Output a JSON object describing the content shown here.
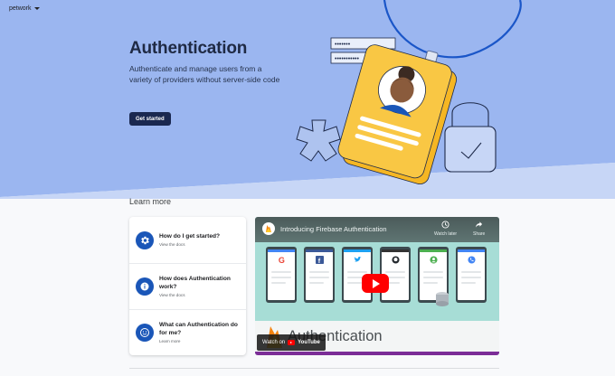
{
  "topbar": {
    "project_label": "petwork"
  },
  "hero": {
    "title": "Authentication",
    "description": "Authenticate and manage users from a variety of providers without server-side code",
    "cta_label": "Get started",
    "password_mask_1": "•••••••",
    "password_mask_2": "•••••••••••"
  },
  "learn_more": {
    "heading": "Learn more",
    "items": [
      {
        "question": "How do I get started?",
        "link": "View the docs",
        "icon": "gear-icon"
      },
      {
        "question": "How does Authentication work?",
        "link": "View the docs",
        "icon": "info-icon"
      },
      {
        "question": "What can Authentication do for me?",
        "link": "Learn more",
        "icon": "smiley-icon"
      }
    ]
  },
  "video": {
    "title": "Introducing Firebase Authentication",
    "watch_later": "Watch later",
    "share": "Share",
    "bottom_title": "Authentication",
    "watch_on": "Watch on",
    "youtube": "YouTube",
    "providers": [
      "google-logo",
      "facebook-logo",
      "twitter-logo",
      "github-logo",
      "anonymous-logo",
      "phone-logo"
    ]
  },
  "colors": {
    "hero_bg": "#9bb6f0",
    "hero_dark": "#1a2850",
    "badge_yellow": "#f5b623",
    "accent_blue": "#1a56b8",
    "youtube_red": "#ff0000"
  }
}
